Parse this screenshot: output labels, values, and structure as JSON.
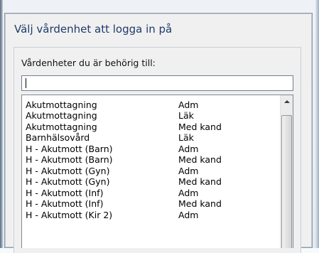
{
  "dialog": {
    "title": "Välj vårdenhet att logga in på",
    "list_label": "Vårdenheter du är behörig till:",
    "search": {
      "value": ""
    },
    "units": [
      {
        "name": "Akutmottagning",
        "role": "Adm"
      },
      {
        "name": "Akutmottagning",
        "role": "Läk"
      },
      {
        "name": "Akutmottagning",
        "role": "Med kand"
      },
      {
        "name": "Barnhälsovård",
        "role": "Läk"
      },
      {
        "name": "H - Akutmott (Barn)",
        "role": "Adm"
      },
      {
        "name": "H - Akutmott (Barn)",
        "role": "Med kand"
      },
      {
        "name": "H - Akutmott (Gyn)",
        "role": "Adm"
      },
      {
        "name": "H - Akutmott (Gyn)",
        "role": "Med kand"
      },
      {
        "name": "H - Akutmott (Inf)",
        "role": "Adm"
      },
      {
        "name": "H - Akutmott (Inf)",
        "role": "Med kand"
      },
      {
        "name": "H - Akutmott (Kir 2)",
        "role": "Adm"
      }
    ]
  },
  "icons": {
    "scroll_up": "chevron-up-icon",
    "caret": "text-caret"
  }
}
